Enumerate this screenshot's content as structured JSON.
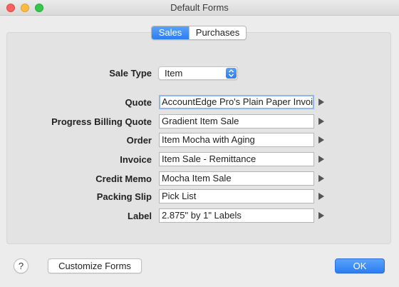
{
  "window": {
    "title": "Default Forms"
  },
  "tabs": {
    "sales": "Sales",
    "purchases": "Purchases",
    "selected": "Sales"
  },
  "sale_type": {
    "label": "Sale Type",
    "value": "Item"
  },
  "forms": [
    {
      "label": "Quote",
      "value": "AccountEdge Pro's Plain Paper Invoice"
    },
    {
      "label": "Progress Billing Quote",
      "value": "Gradient Item Sale"
    },
    {
      "label": "Order",
      "value": "Item Mocha with Aging"
    },
    {
      "label": "Invoice",
      "value": "Item Sale - Remittance"
    },
    {
      "label": "Credit Memo",
      "value": "Mocha Item Sale"
    },
    {
      "label": "Packing Slip",
      "value": "Pick List"
    },
    {
      "label": "Label",
      "value": "2.875\" by 1\" Labels"
    }
  ],
  "footer": {
    "help": "?",
    "customize_label": "Customize Forms",
    "ok_label": "OK"
  },
  "colors": {
    "accent": "#2b7df3",
    "panel": "#e3e3e3",
    "window": "#ececec"
  },
  "icons": {
    "close": "close-icon",
    "minimize": "minimize-icon",
    "maximize": "maximize-icon",
    "popup": "chevron-updown-icon",
    "field_arrow": "triangle-right-icon"
  }
}
